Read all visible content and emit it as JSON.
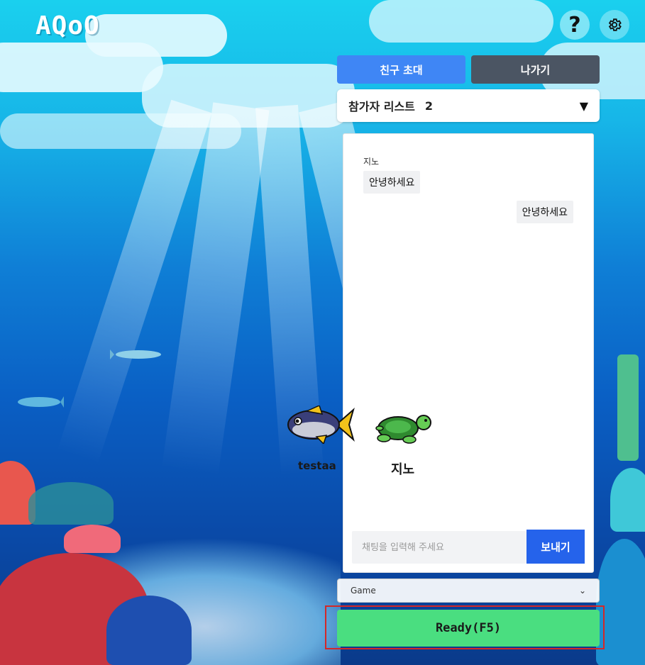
{
  "app": {
    "logo": "AQoO"
  },
  "header": {
    "help_icon": "help-icon",
    "settings_icon": "gear-icon"
  },
  "controls": {
    "invite_label": "친구 초대",
    "leave_label": "나가기"
  },
  "participants": {
    "label": "참가자 리스트",
    "count": "2",
    "caret": "▼"
  },
  "chat": {
    "messages": [
      {
        "sender": "지노",
        "text": "안녕하세요",
        "side": "left"
      },
      {
        "sender": "",
        "text": "안녕하세요",
        "side": "right"
      }
    ],
    "input_placeholder": "채팅을 입력해 주세요",
    "input_value": "",
    "send_label": "보내기"
  },
  "mode_select": {
    "value": "Game",
    "chevron": "⌄"
  },
  "ready": {
    "label": "Ready(F5)"
  },
  "avatars": [
    {
      "name": "testaa",
      "icon": "fish-icon"
    },
    {
      "name": "지노",
      "icon": "turtle-icon"
    }
  ],
  "colors": {
    "invite": "#3f86f5",
    "leave": "#4b5563",
    "send": "#2563eb",
    "ready": "#4ade80",
    "highlight": "#d32828"
  }
}
